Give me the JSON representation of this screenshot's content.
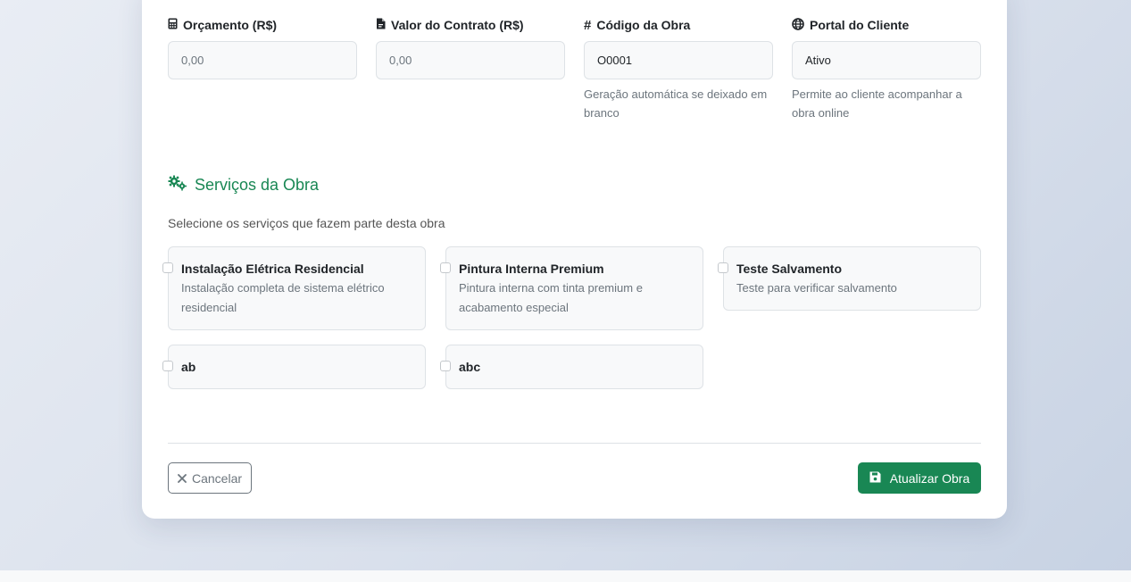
{
  "fields": [
    {
      "label": "Orçamento (R$)",
      "icon": "calculator-icon",
      "value": "",
      "placeholder": "0,00",
      "help": ""
    },
    {
      "label": "Valor do Contrato (R$)",
      "icon": "file-contract-icon",
      "value": "",
      "placeholder": "0,00",
      "help": ""
    },
    {
      "label": "Código da Obra",
      "icon": "hashtag-icon",
      "value": "O0001",
      "placeholder": "",
      "help": "Geração automática se deixado em branco"
    },
    {
      "label": "Portal do Cliente",
      "icon": "globe-icon",
      "value": "Ativo",
      "placeholder": "",
      "help": "Permite ao cliente acompanhar a obra online"
    }
  ],
  "services_section": {
    "title": "Serviços da Obra",
    "icon": "gears-icon",
    "subtitle": "Selecione os serviços que fazem parte desta obra",
    "items": [
      {
        "name": "Instalação Elétrica Residencial",
        "description": "Instalação completa de sistema elétrico residencial",
        "checked": false
      },
      {
        "name": "Pintura Interna Premium",
        "description": "Pintura interna com tinta premium e acabamento especial",
        "checked": false
      },
      {
        "name": "Teste Salvamento",
        "description": "Teste para verificar salvamento",
        "checked": false
      },
      {
        "name": "ab",
        "description": "",
        "checked": false
      },
      {
        "name": "abc",
        "description": "",
        "checked": false
      }
    ]
  },
  "actions": {
    "cancel_label": "Cancelar",
    "cancel_icon": "close-icon",
    "submit_label": "Atualizar Obra",
    "submit_icon": "floppy-disk-icon"
  },
  "colors": {
    "accent": "#198754",
    "muted": "#6c757d",
    "border": "#dee2e6",
    "field_bg": "#f8f9fa"
  }
}
